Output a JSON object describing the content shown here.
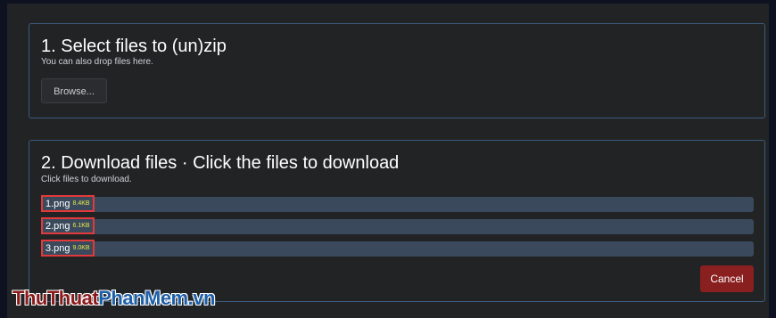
{
  "select_panel": {
    "title": "1. Select files to (un)zip",
    "subtitle": "You can also drop files here.",
    "browse_label": "Browse..."
  },
  "download_panel": {
    "title": "2. Download files · Click the files to download",
    "subtitle": "Click files to download.",
    "files": [
      {
        "name": "1.png",
        "size": "8.4KB"
      },
      {
        "name": "2.png",
        "size": "6.1KB"
      },
      {
        "name": "3.png",
        "size": "9.0KB"
      }
    ],
    "cancel_label": "Cancel"
  },
  "watermark": {
    "part1": "ThuThuat",
    "part2": "PhanMem",
    "part3": ".vn"
  },
  "colors": {
    "background": "#222325",
    "panel_border": "#3b5b7c",
    "file_row": "#3a4a5c",
    "highlight": "#e23a3a",
    "size_text": "#e8e84a",
    "cancel": "#8a1f1f"
  }
}
